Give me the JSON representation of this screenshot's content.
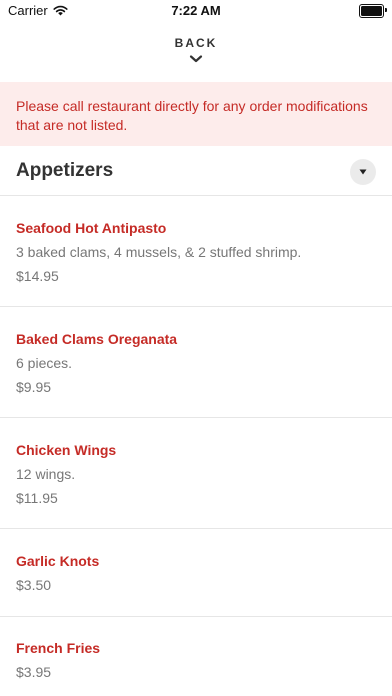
{
  "status_bar": {
    "carrier": "Carrier",
    "time": "7:22 AM",
    "wifi_icon": "wifi-icon",
    "battery_icon": "battery-icon",
    "battery_level": 1.0
  },
  "header": {
    "back_label": "BACK",
    "chevron_icon": "chevron-down-icon"
  },
  "notice": {
    "text": "Please call restaurant directly for any order modifications that are not listed."
  },
  "category": {
    "title": "Appetizers",
    "toggle_icon": "caret-down-icon"
  },
  "menu_items": [
    {
      "name": "Seafood Hot Antipasto",
      "description": "3 baked clams, 4 mussels, & 2 stuffed shrimp.",
      "price": "$14.95"
    },
    {
      "name": "Baked Clams Oreganata",
      "description": "6 pieces.",
      "price": "$9.95"
    },
    {
      "name": "Chicken Wings",
      "description": "12 wings.",
      "price": "$11.95"
    },
    {
      "name": "Garlic Knots",
      "price": "$3.50"
    },
    {
      "name": "French Fries",
      "price": "$3.95"
    }
  ],
  "colors": {
    "accent": "#c52b26",
    "notice_bg": "#fdeceb",
    "muted_text": "#777777",
    "divider": "#e6e6e6"
  }
}
